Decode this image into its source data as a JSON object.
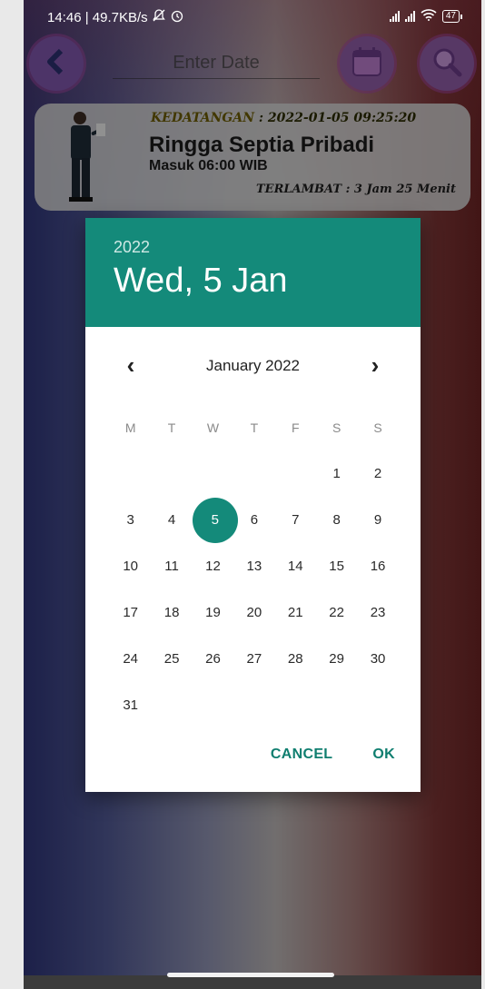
{
  "status_bar": {
    "left_text": "14:46 | 49.7KB/s",
    "battery": "47"
  },
  "top_bar": {
    "date_placeholder": "Enter Date"
  },
  "attendance_card": {
    "arrival_label": "KEDATANGAN",
    "arrival_value": ": 2022-01-05 09:25:20",
    "name": "Ringga Septia Pribadi",
    "shift": "Masuk 06:00 WIB",
    "late_label": "TERLAMBAT",
    "late_value": ": 3 Jam 25 Menit"
  },
  "date_picker": {
    "year": "2022",
    "selected_date": "Wed, 5 Jan",
    "month_label": "January 2022",
    "weekdays": [
      "M",
      "T",
      "W",
      "T",
      "F",
      "S",
      "S"
    ],
    "weeks": [
      [
        "",
        "",
        "",
        "",
        "",
        "1",
        "2"
      ],
      [
        "3",
        "4",
        "5",
        "6",
        "7",
        "8",
        "9"
      ],
      [
        "10",
        "11",
        "12",
        "13",
        "14",
        "15",
        "16"
      ],
      [
        "17",
        "18",
        "19",
        "20",
        "21",
        "22",
        "23"
      ],
      [
        "24",
        "25",
        "26",
        "27",
        "28",
        "29",
        "30"
      ],
      [
        "31",
        "",
        "",
        "",
        "",
        "",
        ""
      ]
    ],
    "selected_day": "5",
    "cancel_label": "CANCEL",
    "ok_label": "OK"
  },
  "colors": {
    "accent": "#148a7a",
    "button_purple": "#8d5ba4"
  }
}
